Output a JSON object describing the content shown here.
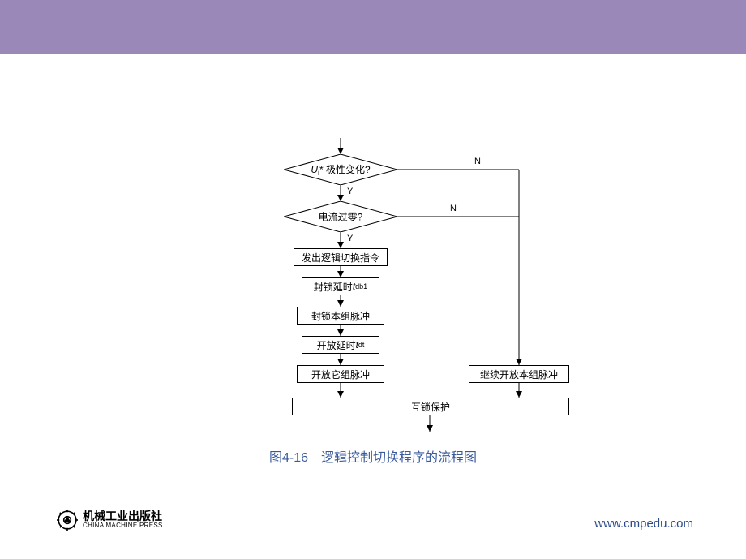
{
  "flow": {
    "decision1": "U*i 极性变化?",
    "decision2": "电流过零?",
    "process1": "发出逻辑切换指令",
    "process2": "封锁延时tdb1",
    "process3": "封锁本组脉冲",
    "process4": "开放延时tdt",
    "process5": "开放它组脉冲",
    "process6": "继续开放本组脉冲",
    "process7": "互锁保护",
    "yes": "Y",
    "no": "N"
  },
  "caption": "图4-16　逻辑控制切换程序的流程图",
  "publisher": {
    "cn": "机械工业出版社",
    "en": "CHINA MACHINE PRESS"
  },
  "website": "www.cmpedu.com"
}
